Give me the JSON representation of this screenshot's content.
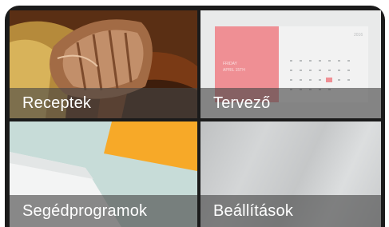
{
  "tiles": [
    {
      "label": "Receptek"
    },
    {
      "label": "Tervező"
    },
    {
      "label": "Segédprogramok"
    },
    {
      "label": "Beállítások"
    }
  ],
  "planner_preview": {
    "day_text": "FRIDAY",
    "date_text": "APRIL 15TH",
    "year_text": "2016"
  },
  "colors": {
    "frame": "#1b1b1b",
    "caption_overlay": "#464646",
    "planner_accent": "#ef8f94",
    "utilities_accent": "#f7a928"
  }
}
